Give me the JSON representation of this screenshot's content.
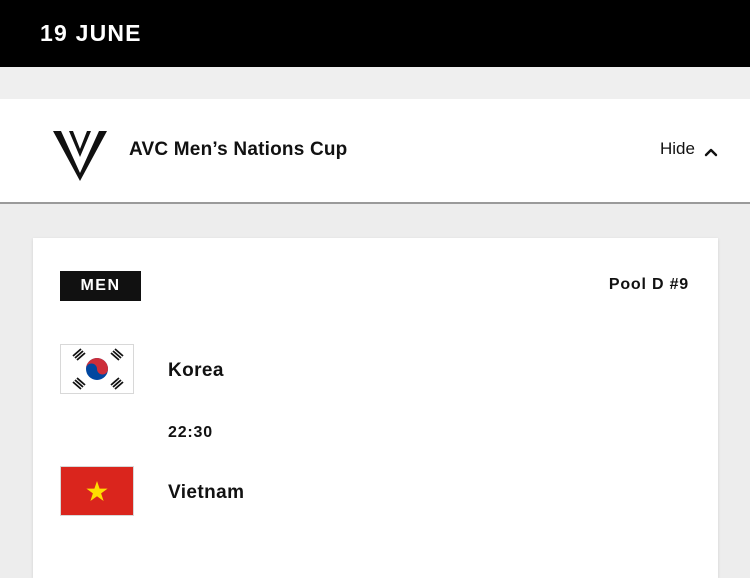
{
  "date_header": {
    "label": "19 JUNE"
  },
  "event": {
    "logo_icon": "volleyball-federation-logo-icon",
    "title": "AVC Men’s Nations Cup",
    "toggle_label": "Hide",
    "toggle_icon": "chevron-up-icon"
  },
  "match": {
    "gender_badge": "MEN",
    "pool": "Pool D #9",
    "time": "22:30",
    "home": {
      "name": "Korea",
      "flag_icon": "korea-flag-icon"
    },
    "away": {
      "name": "Vietnam",
      "flag_icon": "vietnam-flag-icon"
    }
  },
  "colors": {
    "header_bg": "#000000",
    "page_bg": "#ededed",
    "card_bg": "#ffffff",
    "badge_bg": "#111111",
    "vietnam_red": "#da251d",
    "vietnam_star": "#ffdd00",
    "korea_red": "#cd2e3a",
    "korea_blue": "#0047a0"
  }
}
